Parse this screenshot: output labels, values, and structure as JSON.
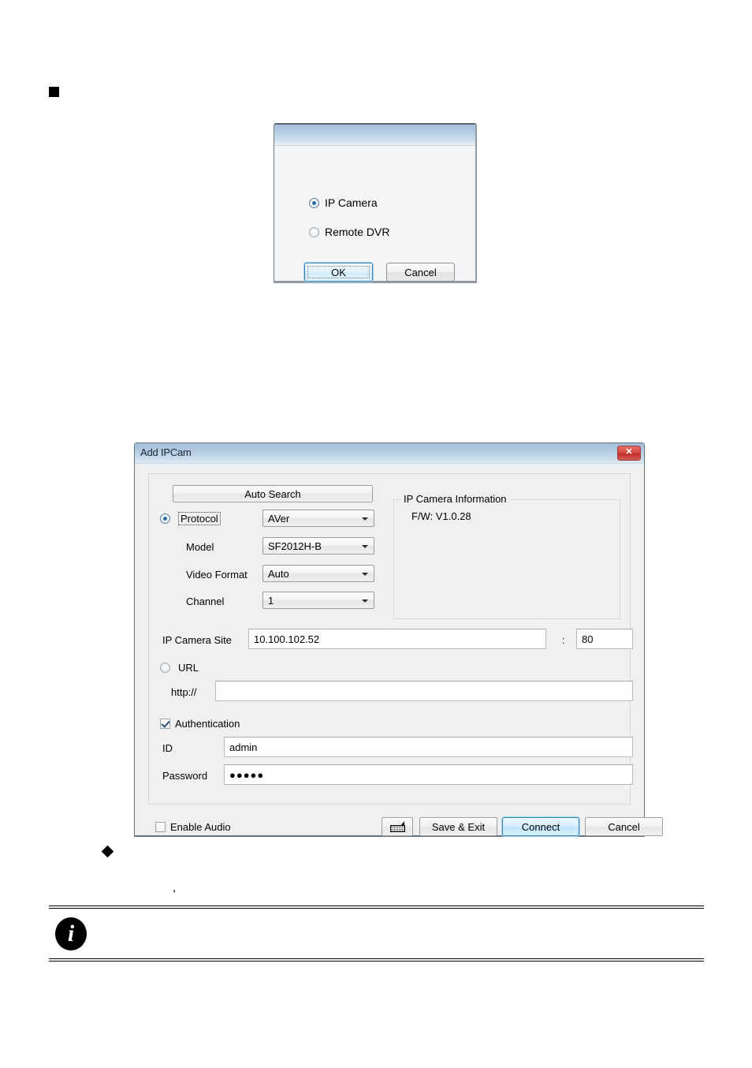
{
  "page": {
    "square_bullet": "■",
    "diamond_bullet": "◆",
    "stray_comma": ",",
    "info_icon_glyph": "i"
  },
  "type_dialog": {
    "title": "",
    "options": [
      {
        "label": "IP Camera",
        "selected": true
      },
      {
        "label": "Remote DVR",
        "selected": false
      }
    ],
    "buttons": [
      {
        "label": "OK",
        "focused": true
      },
      {
        "label": "Cancel",
        "focused": false
      }
    ]
  },
  "ipcam_dialog": {
    "title": "Add IPCam",
    "close_glyph": "✕",
    "auto_search_label": "Auto Search",
    "protocol": {
      "radio_label": "Protocol",
      "selected": true,
      "value": "AVer"
    },
    "model": {
      "label": "Model",
      "value": "SF2012H-B"
    },
    "video_format": {
      "label": "Video Format",
      "value": "Auto"
    },
    "channel": {
      "label": "Channel",
      "value": "1"
    },
    "camera_info": {
      "group_title": "IP Camera Information",
      "firmware": "F/W: V1.0.28"
    },
    "ip_camera_site": {
      "label": "IP Camera Site",
      "value": "10.100.102.52",
      "separator": ":",
      "port": "80"
    },
    "url": {
      "radio_label": "URL",
      "selected": false,
      "scheme_label": "http://",
      "value": ""
    },
    "authentication": {
      "label": "Authentication",
      "checked": true,
      "id_label": "ID",
      "id_value": "admin",
      "password_label": "Password",
      "password_value": "●●●●●"
    },
    "enable_audio": {
      "label": "Enable Audio",
      "checked": false
    },
    "buttons": {
      "keyboard_icon": "keyboard-icon",
      "save_exit": "Save & Exit",
      "connect": "Connect",
      "cancel": "Cancel"
    }
  },
  "colors": {
    "titlebar_start": "#a2bed9",
    "titlebar_end": "#e0ecf6",
    "close_button": "#d64b46",
    "accent_focus": "#3c7fb1",
    "dialog_face": "#f0f0f0"
  }
}
